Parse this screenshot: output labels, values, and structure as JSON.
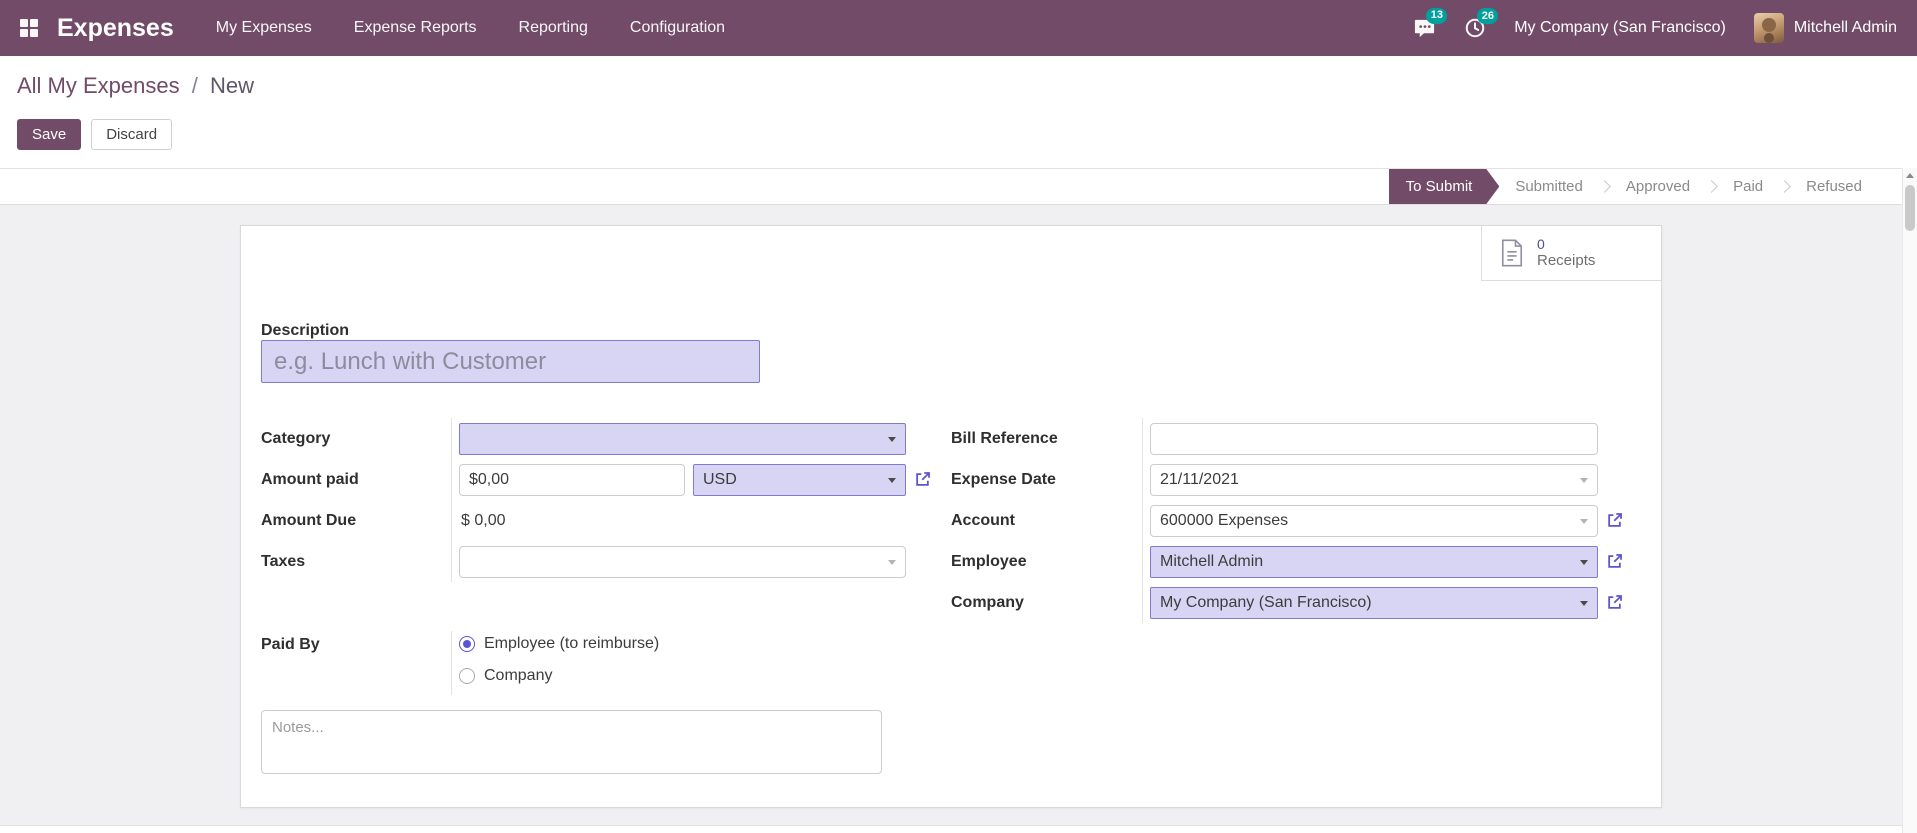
{
  "colors": {
    "navbar_bg": "#714B67",
    "primary": "#714B67",
    "accent": "#5B54CC",
    "notification_badge": "#00A09D",
    "highlight_field_bg": "#D8D4F4",
    "highlight_field_border": "#837AD0",
    "content_bg": "#F0EFF2"
  },
  "navbar": {
    "app_title": "Expenses",
    "menu_items": [
      "My Expenses",
      "Expense Reports",
      "Reporting",
      "Configuration"
    ],
    "messages_count": "13",
    "activities_count": "26",
    "company": "My Company (San Francisco)",
    "user": "Mitchell Admin"
  },
  "breadcrumb": {
    "parent": "All My Expenses",
    "separator": "/",
    "current": "New"
  },
  "actions": {
    "save": "Save",
    "discard": "Discard"
  },
  "statusbar": {
    "steps": [
      {
        "label": "To Submit",
        "active": true
      },
      {
        "label": "Submitted",
        "active": false
      },
      {
        "label": "Approved",
        "active": false
      },
      {
        "label": "Paid",
        "active": false
      },
      {
        "label": "Refused",
        "active": false
      }
    ]
  },
  "form": {
    "receipts": {
      "count": "0",
      "label": "Receipts"
    },
    "description": {
      "label": "Description",
      "placeholder": "e.g. Lunch with Customer"
    },
    "category": {
      "label": "Category",
      "value": ""
    },
    "amount_paid": {
      "label": "Amount paid",
      "value": "$0,00",
      "currency": "USD"
    },
    "amount_due": {
      "label": "Amount Due",
      "value": "$ 0,00"
    },
    "taxes": {
      "label": "Taxes",
      "value": ""
    },
    "paid_by": {
      "label": "Paid By",
      "options": [
        {
          "label": "Employee (to reimburse)",
          "selected": true
        },
        {
          "label": "Company",
          "selected": false
        }
      ]
    },
    "notes_placeholder": "Notes...",
    "bill_reference": {
      "label": "Bill Reference",
      "value": ""
    },
    "expense_date": {
      "label": "Expense Date",
      "value": "21/11/2021"
    },
    "account": {
      "label": "Account",
      "value": "600000 Expenses"
    },
    "employee": {
      "label": "Employee",
      "value": "Mitchell Admin"
    },
    "company": {
      "label": "Company",
      "value": "My Company (San Francisco)"
    }
  }
}
